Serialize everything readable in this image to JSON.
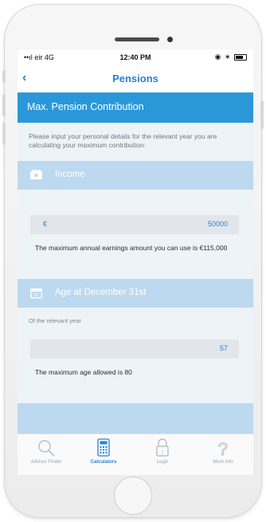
{
  "status": {
    "carrier": "eir 4G",
    "time": "12:40 PM"
  },
  "nav": {
    "back_icon": "chevron-left-icon",
    "title": "Pensions"
  },
  "header": {
    "title": "Max. Pension Contribution"
  },
  "intro": "Please input your personal details for the relevant year you are calculating your maximum contribution:",
  "income": {
    "section_label": "Income",
    "currency": "€",
    "value": "50000",
    "note": "The maximum annual earnings amount you can use is €115,000"
  },
  "age": {
    "section_label": "Age at December 31st",
    "sublabel": "Of the relevant year",
    "value": "57",
    "note": "The maximum age allowed is 80"
  },
  "tabs": [
    {
      "label": "Advisor Finder",
      "icon": "search-icon",
      "active": false
    },
    {
      "label": "Calculators",
      "icon": "calculator-icon",
      "active": true
    },
    {
      "label": "Login",
      "icon": "lock-icon",
      "active": false
    },
    {
      "label": "More Info",
      "icon": "question-icon",
      "active": false
    }
  ],
  "colors": {
    "accent": "#2a7fd4",
    "header": "#2a98d8",
    "section": "#bcd9ef"
  }
}
